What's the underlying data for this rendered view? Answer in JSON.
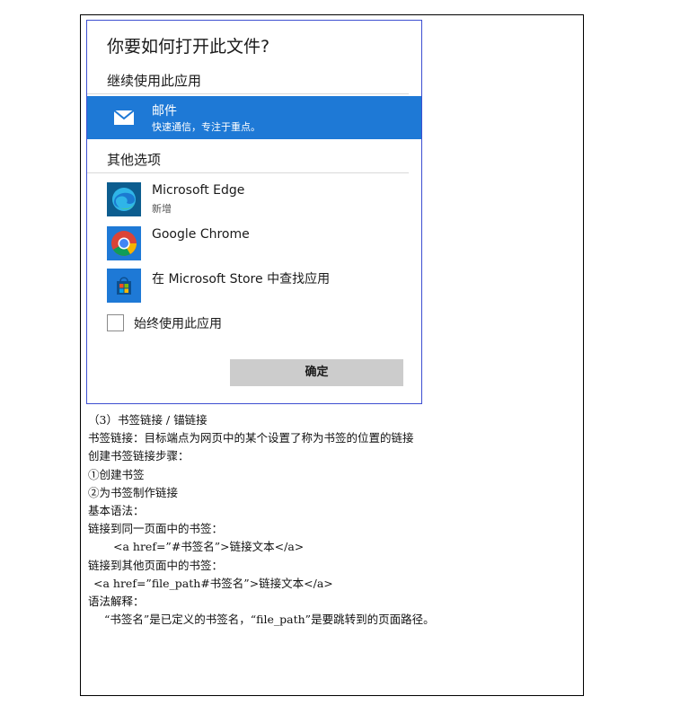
{
  "dialog": {
    "title": "你要如何打开此文件?",
    "section_continue": "继续使用此应用",
    "section_other": "其他选项",
    "apps": [
      {
        "name": "邮件",
        "subtitle": "快速通信，专注于重点。",
        "icon": "mail-icon",
        "selected": true
      },
      {
        "name": "Microsoft Edge",
        "subtitle": "新增",
        "icon": "edge-icon",
        "selected": false
      },
      {
        "name": "Google Chrome",
        "subtitle": "",
        "icon": "chrome-icon",
        "selected": false
      },
      {
        "name": "在 Microsoft Store 中查找应用",
        "subtitle": "",
        "icon": "store-icon",
        "selected": false
      }
    ],
    "always_use_label": "始终使用此应用",
    "ok_label": "确定",
    "colors": {
      "selected_bg": "#1e79d6",
      "dialog_border": "#3d4fd1",
      "button_bg": "#cccccc"
    }
  },
  "doc": {
    "lines": [
      "（3）书签链接 / 锚链接",
      "书签链接：目标端点为网页中的某个设置了称为书签的位置的链接",
      "创建书签链接步骤：",
      "①创建书签",
      "②为书签制作链接",
      "基本语法：",
      "链接到同一页面中的书签：",
      "<a href=”#书签名”>链接文本</a>",
      "链接到其他页面中的书签：",
      "<a href=”file_path#书签名”>链接文本</a>",
      "语法解释：",
      "“书签名”是已定义的书签名，“file_path”是要跳转到的页面路径。"
    ]
  }
}
